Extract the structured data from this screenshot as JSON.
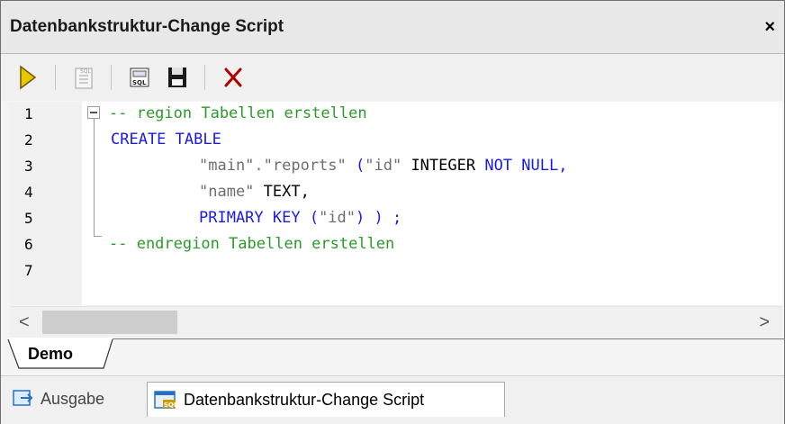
{
  "window": {
    "title": "Datenbankstruktur-Change Script",
    "close_label": "×"
  },
  "toolbar": {
    "buttons": [
      {
        "name": "execute-script-icon"
      },
      {
        "name": "open-in-sql-editor-icon"
      },
      {
        "name": "generate-script-icon"
      },
      {
        "name": "save-script-icon"
      },
      {
        "name": "discard-changes-icon"
      }
    ]
  },
  "editor": {
    "line_numbers": [
      "1",
      "2",
      "3",
      "4",
      "5",
      "6",
      "7"
    ],
    "lines": {
      "l1": "-- region Tabellen erstellen",
      "l2": "CREATE TABLE",
      "l3_a": "\"main\".\"reports\"",
      "l3_b": " (",
      "l3_c": "\"id\"",
      "l3_d": " INTEGER ",
      "l3_e": "NOT NULL,",
      "l4_a": "\"name\"",
      "l4_b": " TEXT,",
      "l5_a": "PRIMARY KEY (",
      "l5_b": "\"id\"",
      "l5_c": ") ) ;",
      "l6": "-- endregion Tabellen erstellen"
    }
  },
  "scrollbar": {
    "left_arrow": "<",
    "right_arrow": ">"
  },
  "tabs": {
    "doc_tab": "Demo"
  },
  "bottom_tabs": {
    "output": "Ausgabe",
    "change_script": "Datenbankstruktur-Change Script"
  },
  "colors": {
    "comment": "#2a9a2a",
    "keyword": "#1a1ae6",
    "string": "#6e6e6e",
    "execute": "#e8c600",
    "discard": "#b00000"
  }
}
